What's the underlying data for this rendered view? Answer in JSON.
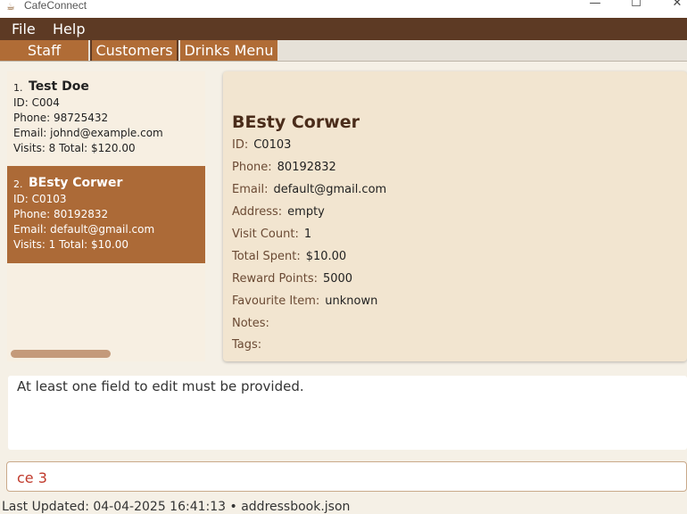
{
  "window": {
    "title": "CafeConnect",
    "minimize": "—",
    "maximize": "☐",
    "close": "✕"
  },
  "menu": {
    "file": "File",
    "help": "Help"
  },
  "tabs": {
    "staff": "Staff",
    "customers": "Customers",
    "drinks": "Drinks Menu"
  },
  "customers": [
    {
      "index": "1.",
      "name": "Test Doe",
      "id": "ID: C004",
      "phone": "Phone: 98725432",
      "email": "Email: johnd@example.com",
      "visits": "Visits: 8   Total: $120.00"
    },
    {
      "index": "2.",
      "name": "BEsty Corwer",
      "id": "ID: C0103",
      "phone": "Phone: 80192832",
      "email": "Email: default@gmail.com",
      "visits": "Visits: 1   Total: $10.00"
    }
  ],
  "detail": {
    "name": "BEsty Corwer",
    "rows": [
      {
        "k": "ID:",
        "v": "C0103"
      },
      {
        "k": "Phone:",
        "v": "80192832"
      },
      {
        "k": "Email:",
        "v": "default@gmail.com"
      },
      {
        "k": "Address:",
        "v": "empty"
      },
      {
        "k": "Visit Count:",
        "v": "1"
      },
      {
        "k": "Total Spent:",
        "v": "$10.00"
      },
      {
        "k": "Reward Points:",
        "v": "5000"
      },
      {
        "k": "Favourite Item:",
        "v": "unknown"
      },
      {
        "k": "Notes:",
        "v": ""
      },
      {
        "k": "Tags:",
        "v": ""
      }
    ]
  },
  "result": {
    "message": "At least one field to edit must be provided."
  },
  "command": {
    "value": "ce 3"
  },
  "status": {
    "text": "Last Updated: 04-04-2025 16:41:13 • addressbook.json"
  }
}
